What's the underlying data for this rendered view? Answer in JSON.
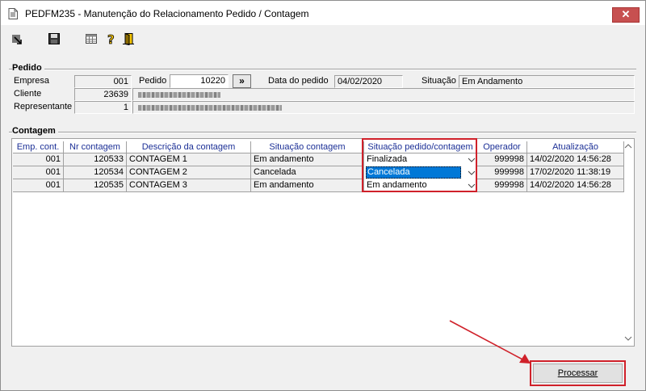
{
  "window": {
    "title": "PEDFM235 - Manutenção do Relacionamento Pedido / Contagem",
    "close_label": "✕"
  },
  "toolbar": {
    "icons": [
      "export-arrow-icon",
      "save-icon",
      "calendar-grid-icon",
      "help-icon",
      "exit-door-icon"
    ]
  },
  "pedido": {
    "group_title": "Pedido",
    "empresa_label": "Empresa",
    "empresa_value": "001",
    "cliente_label": "Cliente",
    "cliente_value": "23639",
    "representante_label": "Representante",
    "representante_value": "1",
    "pedido_label": "Pedido",
    "pedido_value": "10220",
    "goto_label": "»",
    "data_label": "Data do pedido",
    "data_value": "04/02/2020",
    "situacao_label": "Situação",
    "situacao_value": "Em Andamento"
  },
  "contagem": {
    "group_title": "Contagem",
    "columns": [
      "Emp. cont.",
      "Nr contagem",
      "Descrição da contagem",
      "Situação contagem",
      "Situação pedido/contagem",
      "Operador",
      "Atualização"
    ],
    "rows": [
      {
        "emp": "001",
        "nr": "120533",
        "descricao": "CONTAGEM 1",
        "situacao": "Em andamento",
        "situacao_pedido": "Finalizada",
        "operador": "999998",
        "atualizacao": "14/02/2020 14:56:28"
      },
      {
        "emp": "001",
        "nr": "120534",
        "descricao": "CONTAGEM 2",
        "situacao": "Cancelada",
        "situacao_pedido": "Cancelada",
        "operador": "999998",
        "atualizacao": "17/02/2020 11:38:19"
      },
      {
        "emp": "001",
        "nr": "120535",
        "descricao": "CONTAGEM 3",
        "situacao": "Em andamento",
        "situacao_pedido": "Em andamento",
        "operador": "999998",
        "atualizacao": "14/02/2020 14:56:28"
      }
    ]
  },
  "actions": {
    "process_label": "Processar"
  },
  "colors": {
    "header_text": "#1b2f96",
    "highlight": "#d0212a",
    "selection": "#0078d7"
  }
}
